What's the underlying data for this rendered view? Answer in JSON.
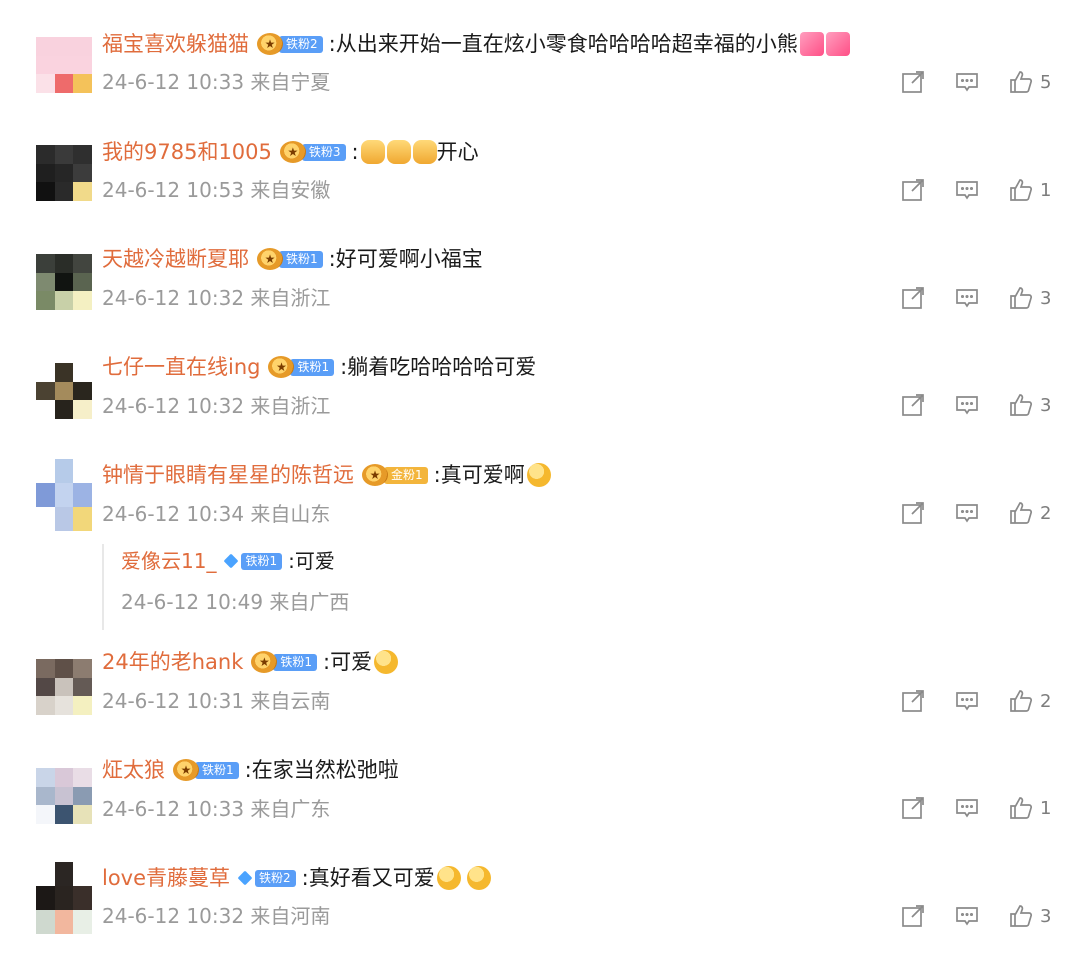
{
  "comments": [
    {
      "user": "福宝喜欢躲猫猫",
      "badge": "铁粉2",
      "badge_type": "crown",
      "text": ":从出来开始一直在炫小零食哈哈哈哈超幸福的小熊",
      "emojis": [
        "heart",
        "heart"
      ],
      "time": "24-6-12 10:33 来自宁夏",
      "likes": "5",
      "avatar": [
        "#f9d2de",
        "#f9d2de",
        "#f9d2de",
        "#fad3df",
        "#fad3df",
        "#fad3df",
        "#fbe1e8",
        "#ee6b6b",
        "#f4c25a"
      ]
    },
    {
      "user": "我的9785和1005",
      "badge": "铁粉3",
      "badge_type": "crown",
      "text": ":",
      "emojis": [
        "hand",
        "hand",
        "hand"
      ],
      "text2": "开心",
      "time": "24-6-12 10:53 来自安徽",
      "likes": "1",
      "avatar": [
        "#2b2b2b",
        "#3a3a3a",
        "#2f2f2f",
        "#1f1f1f",
        "#262626",
        "#3c3c3c",
        "#111111",
        "#2a2a2a",
        "#f1da8a"
      ]
    },
    {
      "user": "天越冷越断夏耶",
      "badge": "铁粉1",
      "badge_type": "crown",
      "text": ":好可爱啊小福宝",
      "emojis": [],
      "time": "24-6-12 10:32 来自浙江",
      "likes": "3",
      "avatar": [
        "#3b3f3a",
        "#2a2d28",
        "#42453f",
        "#7e8a70",
        "#111411",
        "#5a6450",
        "#7a8a66",
        "#c8d0a8",
        "#f4f0c2"
      ]
    },
    {
      "user": "七仔一直在线ing",
      "badge": "铁粉1",
      "badge_type": "crown",
      "text": ":躺着吃哈哈哈哈可爱",
      "emojis": [],
      "time": "24-6-12 10:32 来自浙江",
      "likes": "3",
      "avatar": [
        "#ffffff",
        "#3a3326",
        "#ffffff",
        "#4b4232",
        "#a48b5c",
        "#2a261e",
        "#ffffff",
        "#27231c",
        "#f6efc9"
      ]
    },
    {
      "user": "钟情于眼睛有星星的陈哲远",
      "badge": "金粉1",
      "badge_type": "gold",
      "text": ":真可爱啊",
      "emojis": [
        "face"
      ],
      "time": "24-6-12 10:34 来自山东",
      "likes": "2",
      "avatar": [
        "#ffffff",
        "#b6cbe9",
        "#ffffff",
        "#7f9ad8",
        "#c3d3ef",
        "#9cb3e4",
        "#ffffff",
        "#b9c8e6",
        "#f2d77a"
      ]
    },
    {
      "user": "24年的老hank",
      "badge": "铁粉1",
      "badge_type": "crown",
      "text": ":可爱",
      "emojis": [
        "face"
      ],
      "time": "24-6-12 10:31 来自云南",
      "likes": "2",
      "avatar": [
        "#7a6a60",
        "#5f5048",
        "#8c7c70",
        "#534846",
        "#c9c2bb",
        "#645a55",
        "#d8d2ca",
        "#e6e2dc",
        "#f4f0c0"
      ]
    },
    {
      "user": "炡太狼",
      "badge": "铁粉1",
      "badge_type": "crown",
      "text": ":在家当然松弛啦",
      "emojis": [],
      "time": "24-6-12 10:33 来自广东",
      "likes": "1",
      "avatar": [
        "#c9d5e8",
        "#d9c8d8",
        "#e9dde6",
        "#a9b7cc",
        "#c8c2d2",
        "#8a9bb2",
        "#f4f6fa",
        "#3c5470",
        "#e7e2b8"
      ]
    },
    {
      "user": "love青藤蔓草",
      "badge": "铁粉2",
      "badge_type": "diamond",
      "text": ":真好看又可爱",
      "emojis": [
        "face",
        "face"
      ],
      "time": "24-6-12 10:32 来自河南",
      "likes": "3",
      "avatar": [
        "#ffffff",
        "#2b2623",
        "#ffffff",
        "#1c1816",
        "#2a2420",
        "#3a2f2a",
        "#cfd9cf",
        "#f2b79e",
        "#e8efe6"
      ]
    }
  ],
  "reply": {
    "user": "爱像云11_",
    "badge": "铁粉1",
    "text": ":可爱",
    "time": "24-6-12 10:49 来自广西"
  }
}
